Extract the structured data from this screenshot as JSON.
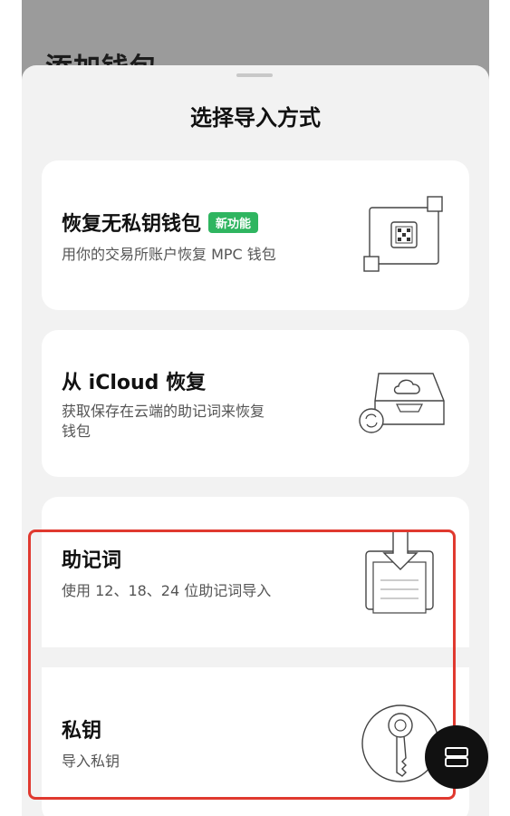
{
  "background": {
    "title": "添加钱包"
  },
  "sheet": {
    "title": "选择导入方式",
    "options": [
      {
        "title": "恢复无私钥钱包",
        "badge": "新功能",
        "description": "用你的交易所账户恢复 MPC 钱包",
        "icon": "mpc-chip-icon"
      },
      {
        "title": "从 iCloud 恢复",
        "description_line1": "获取保存在云端的助记词来恢复",
        "description_line2": "钱包",
        "icon": "icloud-drive-icon"
      },
      {
        "title": "助记词",
        "description": "使用 12、18、24 位助记词导入",
        "icon": "mnemonic-import-icon"
      },
      {
        "title": "私钥",
        "description": "导入私钥",
        "icon": "key-icon"
      }
    ]
  },
  "colors": {
    "highlight": "#e0392f",
    "badge": "#2fb560",
    "fab": "#111111"
  },
  "fab": {
    "icon": "menu-icon"
  }
}
